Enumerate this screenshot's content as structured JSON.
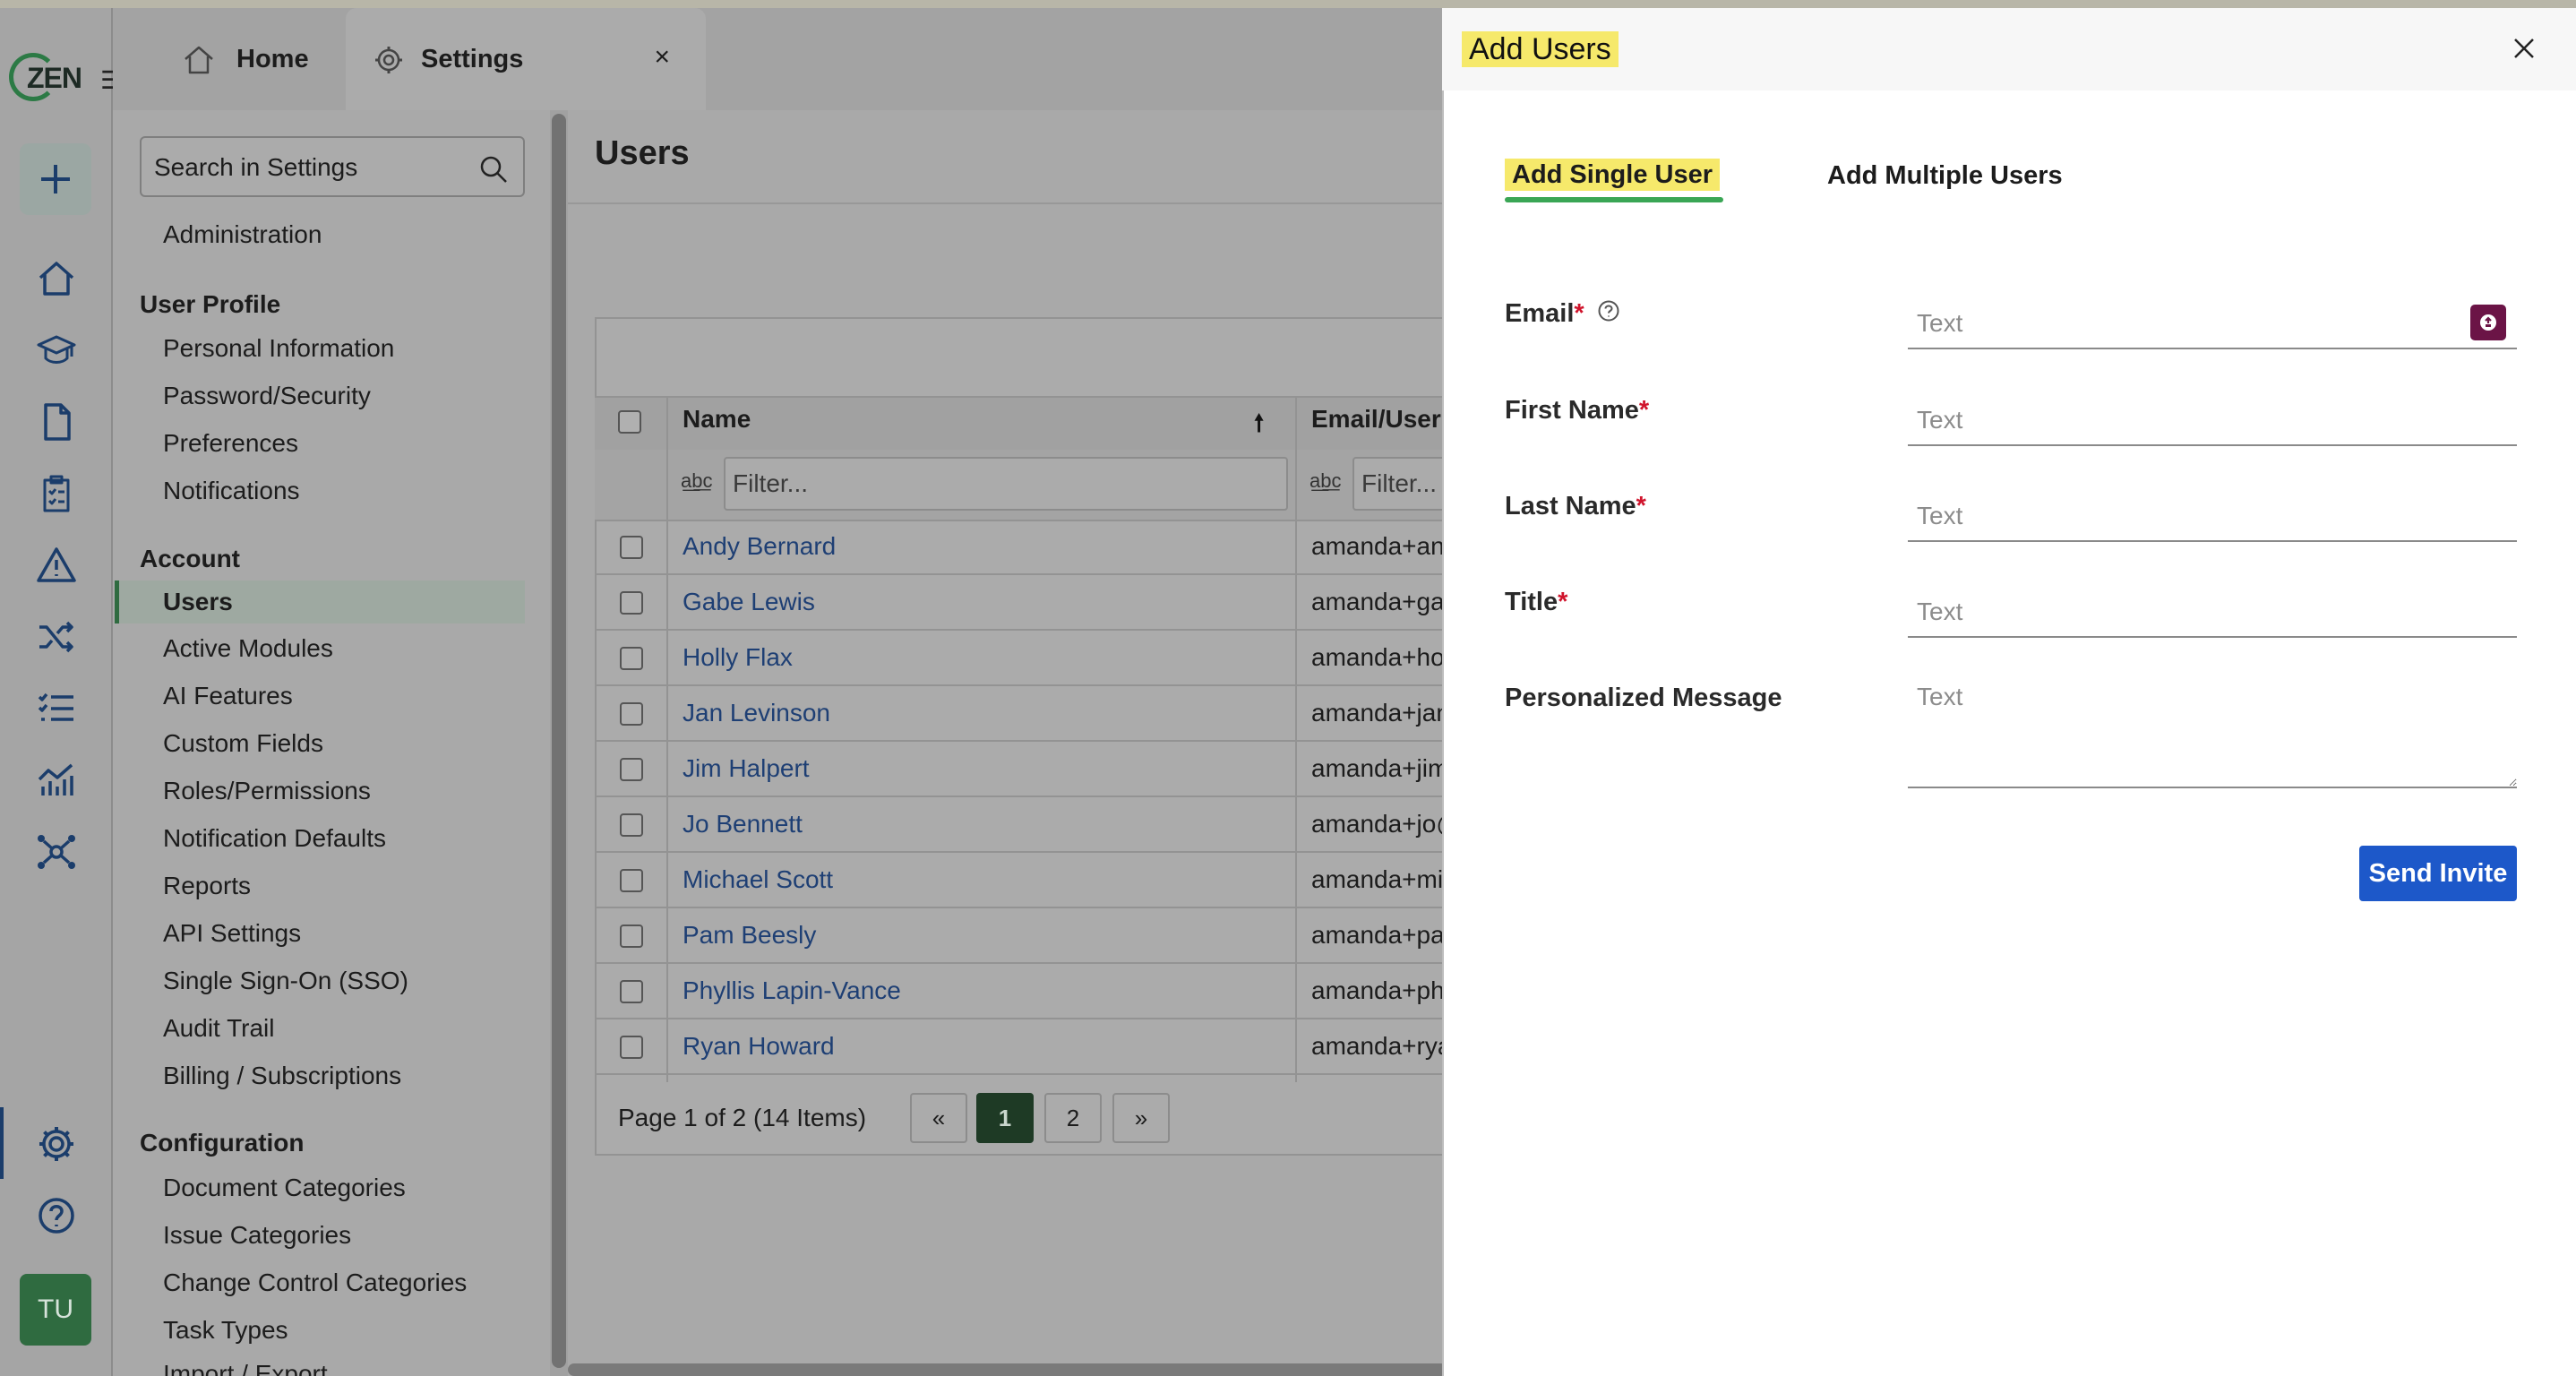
{
  "app": {
    "logo_text": "ZEN"
  },
  "tabs": {
    "home": "Home",
    "settings": "Settings",
    "close_symbol": "×"
  },
  "rail": {
    "icons": [
      "plus-icon",
      "home-icon",
      "graduation-cap-icon",
      "document-icon",
      "clipboard-checklist-icon",
      "warning-triangle-icon",
      "shuffle-icon",
      "task-list-icon",
      "analytics-chart-icon",
      "network-hub-icon",
      "gear-icon",
      "help-circle-icon"
    ],
    "avatar_initials": "TU"
  },
  "sidebar": {
    "search_placeholder": "Search in Settings",
    "administration": "Administration",
    "user_profile": {
      "heading": "User Profile",
      "items": [
        "Personal Information",
        "Password/Security",
        "Preferences",
        "Notifications"
      ]
    },
    "account": {
      "heading": "Account",
      "items": [
        "Users",
        "Active Modules",
        "AI Features",
        "Custom Fields",
        "Roles/Permissions",
        "Notification Defaults",
        "Reports",
        "API Settings",
        "Single Sign-On (SSO)",
        "Audit Trail",
        "Billing / Subscriptions"
      ],
      "active": "Users"
    },
    "configuration": {
      "heading": "Configuration",
      "items": [
        "Document Categories",
        "Issue Categories",
        "Change Control Categories",
        "Task Types",
        "Import / Export"
      ]
    }
  },
  "users_page": {
    "title": "Users",
    "columns": {
      "name": "Name",
      "email": "Email/UserI"
    },
    "filter_placeholder": "Filter...",
    "rows": [
      {
        "name": "Andy Bernard",
        "email": "amanda+and"
      },
      {
        "name": "Gabe Lewis",
        "email": "amanda+gab"
      },
      {
        "name": "Holly Flax",
        "email": "amanda+ho"
      },
      {
        "name": "Jan Levinson",
        "email": "amanda+jan"
      },
      {
        "name": "Jim Halpert",
        "email": "amanda+jim"
      },
      {
        "name": "Jo Bennett",
        "email": "amanda+jo@"
      },
      {
        "name": "Michael Scott",
        "email": "amanda+mic"
      },
      {
        "name": "Pam Beesly",
        "email": "amanda+par"
      },
      {
        "name": "Phyllis Lapin-Vance",
        "email": "amanda+phy"
      },
      {
        "name": "Ryan Howard",
        "email": "amanda+rya"
      }
    ],
    "pager": {
      "summary": "Page 1 of 2 (14 Items)",
      "prev": "«",
      "pages": [
        "1",
        "2"
      ],
      "next": "»",
      "current": "1"
    }
  },
  "drawer": {
    "title": "Add Users",
    "tabs": {
      "single": "Add Single User",
      "multiple": "Add Multiple Users"
    },
    "fields": {
      "email": {
        "label": "Email",
        "placeholder": "Text"
      },
      "first_name": {
        "label": "First Name",
        "placeholder": "Text"
      },
      "last_name": {
        "label": "Last Name",
        "placeholder": "Text"
      },
      "title": {
        "label": "Title",
        "placeholder": "Text"
      },
      "message": {
        "label": "Personalized Message",
        "placeholder": "Text"
      }
    },
    "required_marker": "*",
    "submit": "Send Invite"
  },
  "colors": {
    "accent_green": "#2f6b40",
    "tab_underline": "#3aa655",
    "primary_button": "#1d58c9",
    "highlight": "#f6e96b",
    "link_blue": "#1e3f74",
    "required": "#d0142c"
  }
}
